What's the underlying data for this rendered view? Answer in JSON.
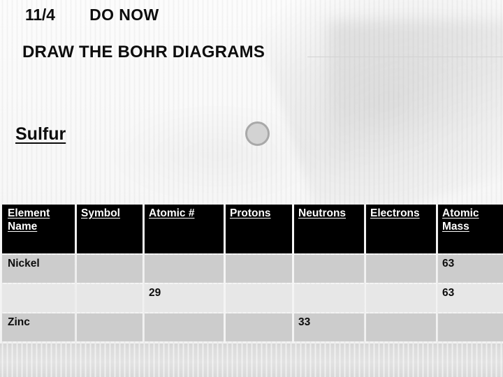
{
  "slide": {
    "header": {
      "date": "11/4",
      "do_now": "DO NOW",
      "instruction": "DRAW THE BOHR DIAGRAMS"
    },
    "diagram": {
      "element_label": "Sulfur",
      "nucleus_icon": "circle-outline-icon",
      "nucleus_fill_color": "#d3d3d3",
      "nucleus_border_color": "#a8a8a8"
    },
    "table": {
      "header_background_color": "#000000",
      "header_text_color": "#ffffff",
      "row_shade_a_color": "#cccccc",
      "row_shade_b_color": "#e7e7e7",
      "columns": [
        "Element Name",
        "Symbol",
        "Atomic  #",
        "Protons",
        "Neutrons",
        "Electrons",
        "Atomic Mass"
      ],
      "rows": [
        {
          "shade": "a",
          "cells": [
            "Nickel",
            "",
            "",
            "",
            "",
            "",
            "63"
          ]
        },
        {
          "shade": "b",
          "cells": [
            "",
            "",
            "29",
            "",
            "",
            "",
            "63"
          ]
        },
        {
          "shade": "a",
          "cells": [
            "Zinc",
            "",
            "",
            "",
            "33",
            "",
            ""
          ]
        }
      ]
    }
  }
}
